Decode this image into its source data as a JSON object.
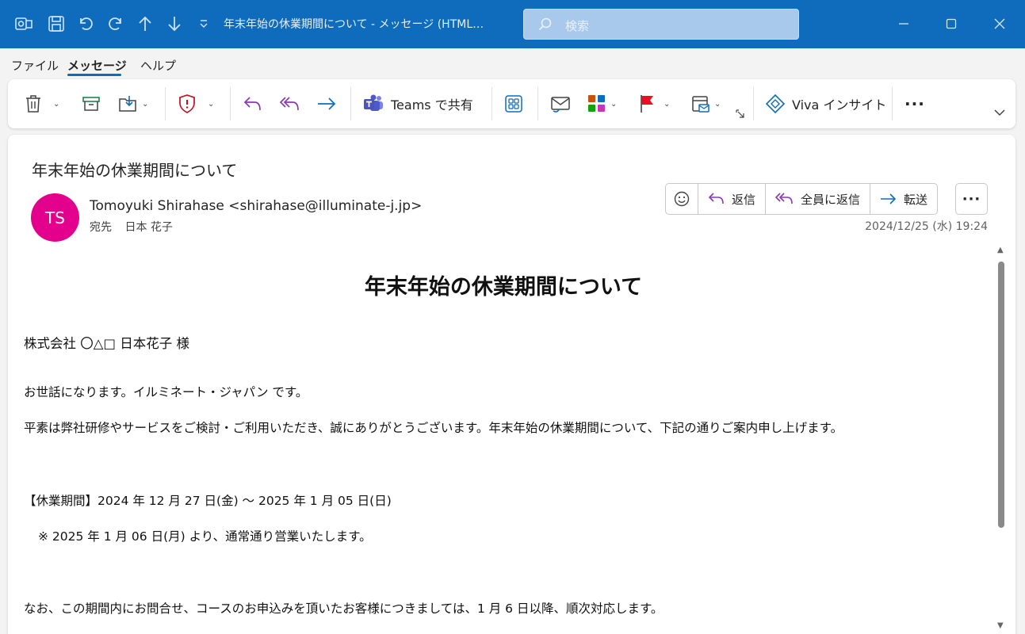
{
  "titlebar": {
    "title": "年末年始の休業期間について  -  メッセージ (HTML…",
    "search_placeholder": "検索",
    "icons": [
      "outlook-icon",
      "save-icon",
      "undo-icon",
      "redo-icon",
      "up-arrow-icon",
      "down-arrow-icon",
      "customize-dropdown-icon"
    ],
    "accent": "#0f6cbd"
  },
  "menu": {
    "items": [
      {
        "label": "ファイル"
      },
      {
        "label": "メッセージ"
      },
      {
        "label": "ヘルプ"
      }
    ],
    "active": "メッセージ"
  },
  "ribbon": {
    "teams_label": "Teams で共有",
    "viva_label": "Viva インサイト",
    "more_label": "···"
  },
  "message": {
    "subject": "年末年始の休業期間について",
    "avatar_initials": "TS",
    "avatar_color": "#e3008c",
    "from": "Tomoyuki Shirahase <shirahase@illuminate-j.jp>",
    "to_label": "宛先",
    "to_name": "日本 花子",
    "date": "2024/12/25 (水) 19:24",
    "actions": {
      "reply": "返信",
      "reply_all": "全員に返信",
      "forward": "転送",
      "more": "···"
    }
  },
  "body": {
    "title": "年末年始の休業期間について",
    "addressee": "株式会社 〇△□  日本花子 様",
    "greeting": "お世話になります。イルミネート・ジャパン です。",
    "intro": "平素は弊社研修やサービスをご検討・ご利用いただき、誠にありがとうございます。年末年始の休業期間について、下記の通りご案内申し上げます。",
    "period": "【休業期間】2024 年 12 月 27 日(金) 〜 2025 年 1 月 05 日(日)",
    "resume": "※ 2025 年 1 月 06 日(月) より、通常通り営業いたします。",
    "note": "なお、この期間内にお問合せ、コースのお申込みを頂いたお客様につきましては、1 月 6 日以降、順次対応します。"
  }
}
